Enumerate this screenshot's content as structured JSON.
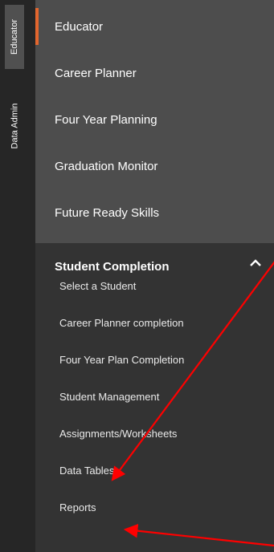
{
  "rail": {
    "tabs": [
      "Educator",
      "Data Admin"
    ]
  },
  "menu": {
    "items": [
      "Educator",
      "Career Planner",
      "Four Year Planning",
      "Graduation Monitor",
      "Future Ready Skills"
    ],
    "section": {
      "title": "Student Completion",
      "items": [
        "Select a Student",
        "Career Planner completion",
        "Four Year Plan Completion",
        "Student Management",
        "Assignments/Worksheets",
        "Data Tables",
        "Reports"
      ]
    }
  },
  "colors": {
    "accent": "#e3662e",
    "annotation": "#ff0000"
  },
  "icons": {
    "section_toggle": "chevron-up-icon",
    "annotation": "arrow-annotation"
  }
}
